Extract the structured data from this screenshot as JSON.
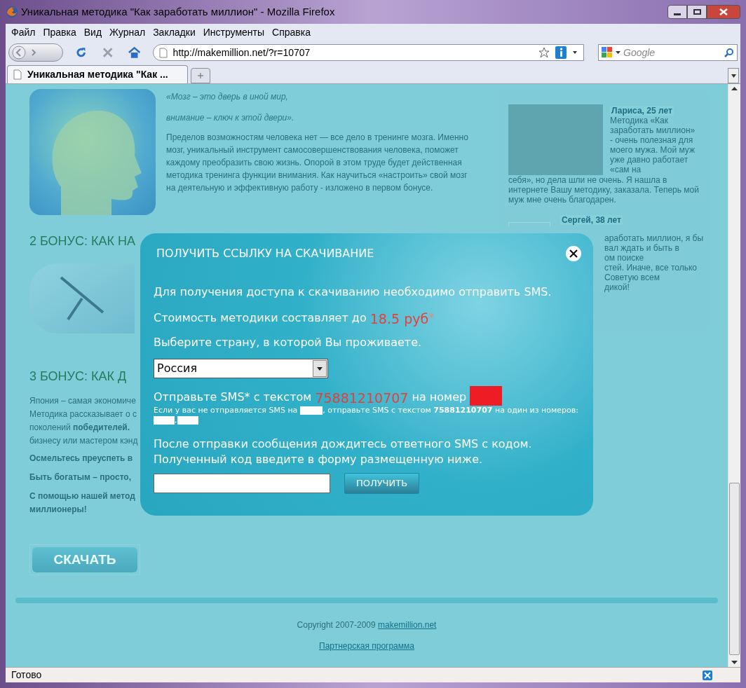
{
  "window": {
    "title": "Уникальная методика \"Как заработать миллион\" - Mozilla Firefox"
  },
  "menu": [
    "Файл",
    "Правка",
    "Вид",
    "Журнал",
    "Закладки",
    "Инструменты",
    "Справка"
  ],
  "nav": {
    "url": "http://makemillion.net/?r=10707",
    "search_placeholder": "Google"
  },
  "tabs": [
    {
      "label": "Уникальная методика \"Как ...",
      "selected": true
    }
  ],
  "page": {
    "quote": [
      "«Мозг – это дверь в иной мир,",
      "внимание – ключ к этой двери»."
    ],
    "intro": "Пределов возможностям человека нет — все дело в тренинге мозга. Именно мозг, уникальный инструмент самосовершенствования человека, поможет каждому преобразить свою жизнь. Опорой в этом труде будет действенная методика тренинга функции внимания. Как научиться «настроить» свой мозг на деятельную и эффективную работу - изложено в первом бонусе.",
    "bonus2": "2 БОНУС: КАК НА",
    "bonus3": "3 БОНУС: КАК Д",
    "bonus3_lines": [
      "Япония – самая экономиче",
      "Методика рассказывает о с",
      "поколений **победителей.**",
      "бизнесу или мастером кэнд"
    ],
    "bold_lines": [
      "Осмельтесь преуспеть в",
      "Быть богатым – просто,",
      "С помощью нашей метод\nмиллионеры!"
    ],
    "download": "СКАЧАТЬ",
    "copyright": "Copyright 2007-2009 ",
    "copyright_link": "makemillion.net",
    "partner": "Партнерская программа",
    "reviews": [
      {
        "name": "Лариса, 25 лет",
        "text_beside": "Методика «Как заработать миллион» - очень полезная для моего мужа. Мой муж уже давно работает «сам на",
        "text_below": "себя», но дела шли не очень. Я нашла в интернете Вашу методику, заказала. Теперь мой муж мне очень благодарен."
      },
      {
        "name": "Сергей, 38 лет",
        "lines": [
          "аработать миллион, я бы",
          "вал ждать и быть в",
          "ом поиске",
          "стей. Иначе, все только",
          "Советую всем",
          "дикой!"
        ]
      }
    ]
  },
  "modal": {
    "title": "ПОЛУЧИТЬ ССЫЛКУ НА СКАЧИВАНИЕ",
    "line1": "Для получения доступа к скачиванию необходимо отправить SMS.",
    "cost": "Стоимость методики составляет до ",
    "price": "18.5 руб",
    "price_mark": "*",
    "line3": "Выберите страну, в которой Вы проживаете.",
    "country": "Россия",
    "sms_prefix": "Отправьте SMS* с текстом ",
    "sms_code": "75881210707",
    "sms_mid": " на номер ",
    "alt1": "Если у вас не отправляется SMS на",
    "alt2": ", отправьте SMS с текстом **75881210707** на один из номеров:",
    "alt_sep": ",",
    "after": [
      "После отправки сообщения дождитесь ответного SMS с кодом.",
      "Полученный код введите в форму размещенную ниже."
    ],
    "button": "ПОЛУЧИТЬ"
  },
  "status": "Готово"
}
